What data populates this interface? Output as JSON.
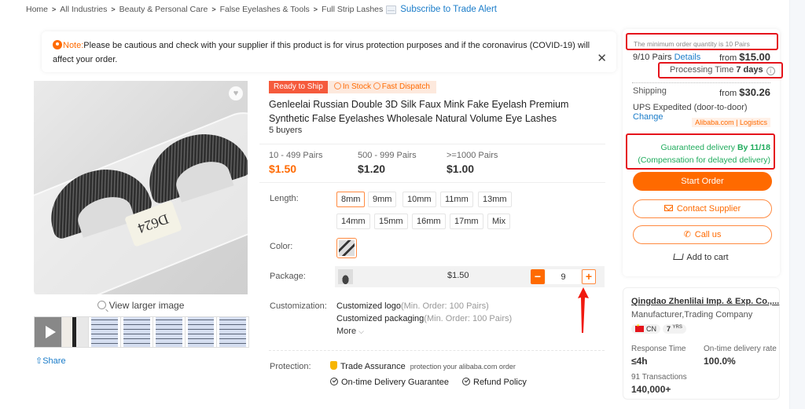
{
  "breadcrumb": {
    "items": [
      "Home",
      "All Industries",
      "Beauty & Personal Care",
      "False Eyelashes & Tools",
      "Full Strip Lashes"
    ],
    "subscribe": "Subscribe to Trade Alert"
  },
  "note": {
    "label": "Note:",
    "text": "Please be cautious and check with your supplier if this product is for virus protection purposes and if the coronavirus (COVID-19) will affect your order.",
    "close": "✕"
  },
  "gallery": {
    "image_label": "D624",
    "view_larger": "View larger image",
    "share": "Share",
    "thumbnails": [
      "video",
      "model",
      "sheet",
      "sheet",
      "sheet",
      "sheet",
      "sheet"
    ]
  },
  "product": {
    "badge_ready": "Ready to Ship",
    "badge_stock": "In Stock",
    "badge_dispatch": "Fast Dispatch",
    "title": "Genleelai Russian Double 3D Silk Faux Mink Fake Eyelash Premium Synthetic False Eyelashes Wholesale Natural Volume Eye Lashes",
    "buyers": "5 buyers",
    "tiers": [
      {
        "qty": "10 - 499 Pairs",
        "price": "$1.50"
      },
      {
        "qty": "500 - 999 Pairs",
        "price": "$1.20"
      },
      {
        "qty": ">=1000 Pairs",
        "price": "$1.00"
      }
    ],
    "length_label": "Length:",
    "lengths": [
      "8mm",
      "9mm",
      "10mm",
      "11mm",
      "13mm",
      "14mm",
      "15mm",
      "16mm",
      "17mm",
      "Mix"
    ],
    "selected_length": "8mm",
    "color_label": "Color:",
    "package_label": "Package:",
    "package_price": "$1.50",
    "quantity": "9",
    "minus": "−",
    "plus": "+",
    "customization_label": "Customization:",
    "customizations": [
      {
        "name": "Customized logo",
        "min": "(Min. Order: 100 Pairs)"
      },
      {
        "name": "Customized packaging",
        "min": "(Min. Order: 100 Pairs)"
      }
    ],
    "more": "More",
    "protection_label": "Protection:",
    "trade_assurance": "Trade Assurance",
    "trade_assurance_note": "protection your alibaba.com order",
    "ontime": "On-time Delivery Guarantee",
    "refund": "Refund Policy"
  },
  "order": {
    "moq": "The minimum order quantity is 10 Pairs",
    "pairs": "9/10 Pairs",
    "details": "Details",
    "from": "from",
    "price": "$15.00",
    "processing_label": "Processing Time",
    "processing_value": "7 days",
    "shipping_label": "Shipping",
    "shipping_price": "$30.26",
    "shipping_method": "UPS Expedited (door-to-door)",
    "change": "Change",
    "logistics": "Alibaba.com | Logistics",
    "guaranteed": "Guaranteed delivery",
    "by_date": "By 11/18",
    "compensation": "(Compensation for delayed delivery)",
    "start_order": "Start Order",
    "contact": "Contact Supplier",
    "call": "Call us",
    "cart": "Add to cart",
    "colors": {
      "accent": "#ff6a00",
      "green": "#1fab5c",
      "link": "#1a7cc9",
      "highlight": "#e5141c"
    }
  },
  "supplier": {
    "name": "Qingdao Zhenlilai Imp. & Exp. Co.,...",
    "type": "Manufacturer,Trading Company",
    "country": "CN",
    "years": "7",
    "years_unit": "YRS",
    "response_label": "Response Time",
    "response_value": "≤4h",
    "ontime_label": "On-time delivery rate",
    "ontime_value": "100.0%",
    "transactions_label": "91 Transactions",
    "transactions_value": "140,000+"
  }
}
